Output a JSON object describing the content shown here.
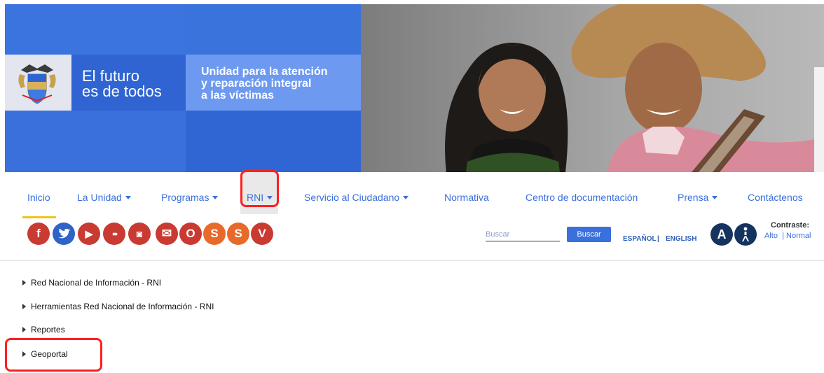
{
  "banner": {
    "slogan_line1": "El futuro",
    "slogan_line2": "es de todos",
    "entity_line1": "Unidad para la atención",
    "entity_line2": "y reparación integral",
    "entity_line3": "a las víctimas"
  },
  "nav": {
    "items": [
      {
        "label": "Inicio",
        "dropdown": false,
        "active": true
      },
      {
        "label": "La Unidad",
        "dropdown": true
      },
      {
        "label": "Programas",
        "dropdown": true
      },
      {
        "label": "RNI",
        "dropdown": true,
        "highlighted": true
      },
      {
        "label": "Servicio al Ciudadano",
        "dropdown": true
      },
      {
        "label": "Normativa",
        "dropdown": false
      },
      {
        "label": "Centro de documentación",
        "dropdown": false
      },
      {
        "label": "Prensa",
        "dropdown": true
      },
      {
        "label": "Contáctenos",
        "dropdown": false
      }
    ]
  },
  "social": [
    {
      "icon": "facebook-icon",
      "glyph": "f",
      "color": "#c93a32"
    },
    {
      "icon": "twitter-icon",
      "glyph": "",
      "color": "#2f63c6"
    },
    {
      "icon": "youtube-icon",
      "glyph": "▶",
      "color": "#c93a32"
    },
    {
      "icon": "flickr-icon",
      "glyph": "••",
      "color": "#c93a32"
    },
    {
      "icon": "instagram-icon",
      "glyph": "◙",
      "color": "#c93a32"
    },
    {
      "icon": "email-icon",
      "glyph": "✉",
      "color": "#c93a32"
    },
    {
      "icon": "o-icon",
      "glyph": "O",
      "color": "#c93a32"
    },
    {
      "icon": "s-icon",
      "glyph": "S",
      "color": "#e86a2a"
    },
    {
      "icon": "s-icon",
      "glyph": "S",
      "color": "#e86a2a"
    },
    {
      "icon": "v-icon",
      "glyph": "V",
      "color": "#c93a32"
    }
  ],
  "search": {
    "placeholder": "Buscar",
    "button_label": "Buscar"
  },
  "language": {
    "spanish": "ESPAÑOL",
    "separator": "|",
    "english": "ENGLISH"
  },
  "accessibility": {
    "text_size_glyph": "A",
    "contrast_title": "Contraste:",
    "contrast_high": "Alto",
    "contrast_sep": "|",
    "contrast_normal": "Normal"
  },
  "submenu": {
    "items": [
      {
        "label": "Red Nacional de Información - RNI"
      },
      {
        "label": "Herramientas Red Nacional de Información - RNI"
      },
      {
        "label": "Reportes"
      },
      {
        "label": "Geoportal",
        "highlighted": true
      }
    ]
  },
  "colors": {
    "brand_blue": "#3a70dc",
    "highlight_red": "#ff1f1f",
    "active_yellow": "#f1c21b",
    "navy": "#15335f"
  }
}
